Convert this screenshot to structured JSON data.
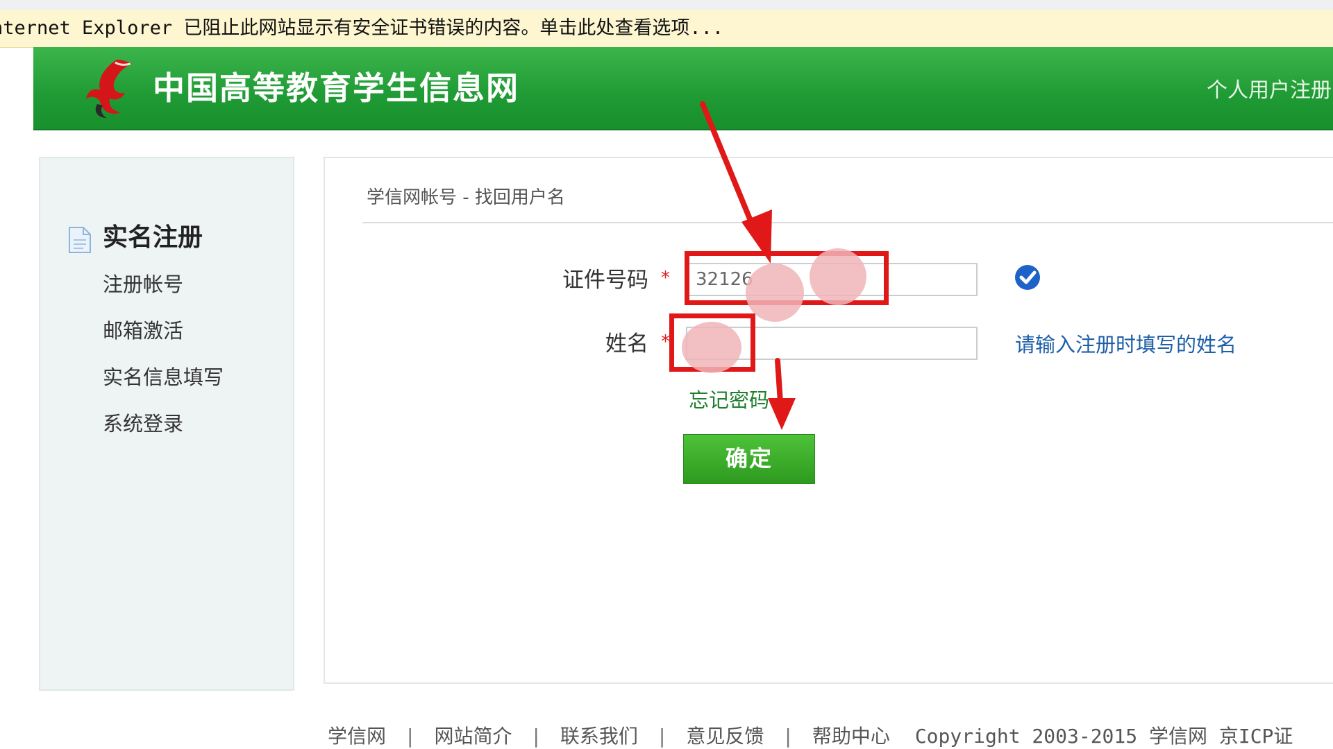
{
  "ie_infobar": {
    "text": "nternet Explorer 已阻止此网站显示有安全证书错误的内容。单击此处查看选项..."
  },
  "header": {
    "site_title": "中国高等教育学生信息网",
    "top_link": "个人用户注册",
    "logo_icon": "red-bird-logo-icon",
    "bg_color": "#1f9a34"
  },
  "sidebar": {
    "heading": "实名注册",
    "heading_icon": "document-icon",
    "items": [
      {
        "label": "注册帐号"
      },
      {
        "label": "邮箱激活"
      },
      {
        "label": "实名信息填写"
      },
      {
        "label": "系统登录"
      }
    ]
  },
  "main": {
    "breadcrumb": "学信网帐号 - 找回用户名",
    "form": {
      "id_label": "证件号码",
      "id_value": "32126",
      "id_valid_icon": "check-circle-icon",
      "name_label": "姓名",
      "name_value": "",
      "name_hint": "请输入注册时填写的姓名",
      "required_mark": "*",
      "forgot_link": "忘记密码",
      "confirm_button": "确定"
    }
  },
  "footer": {
    "links": [
      "学信网",
      "网站简介",
      "联系我们",
      "意见反馈",
      "帮助中心"
    ],
    "copyright": "Copyright 2003-2015 学信网 京ICP证"
  },
  "colors": {
    "annotation_red": "#e01818",
    "link_blue": "#1e5fa8",
    "button_green": "#2d9a1e"
  }
}
